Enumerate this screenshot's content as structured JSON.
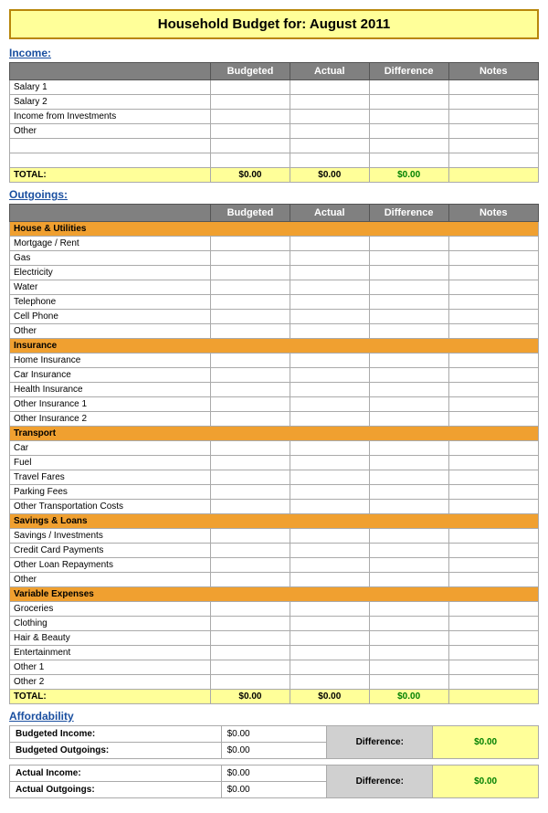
{
  "title": {
    "prefix": "Household Budget for:",
    "month": "August 2011",
    "full": "Household Budget for:   August 2011"
  },
  "income": {
    "section_label": "Income:",
    "headers": [
      "",
      "Budgeted",
      "Actual",
      "Difference",
      "Notes"
    ],
    "items": [
      "Salary 1",
      "Salary 2",
      "Income from Investments",
      "Other"
    ],
    "total_label": "TOTAL:",
    "total_budgeted": "$0.00",
    "total_actual": "$0.00",
    "total_difference": "$0.00"
  },
  "outgoings": {
    "section_label": "Outgoings:",
    "headers": [
      "",
      "Budgeted",
      "Actual",
      "Difference",
      "Notes"
    ],
    "categories": [
      {
        "name": "House & Utilities",
        "items": [
          "Mortgage / Rent",
          "Gas",
          "Electricity",
          "Water",
          "Telephone",
          "Cell Phone",
          "Other"
        ]
      },
      {
        "name": "Insurance",
        "items": [
          "Home Insurance",
          "Car Insurance",
          "Health Insurance",
          "Other Insurance 1",
          "Other Insurance 2"
        ]
      },
      {
        "name": "Transport",
        "items": [
          "Car",
          "Fuel",
          "Travel Fares",
          "Parking Fees",
          "Other Transportation Costs"
        ]
      },
      {
        "name": "Savings & Loans",
        "items": [
          "Savings / Investments",
          "Credit Card Payments",
          "Other Loan Repayments",
          "Other"
        ]
      },
      {
        "name": "Variable Expenses",
        "items": [
          "Groceries",
          "Clothing",
          "Hair & Beauty",
          "Entertainment",
          "Other 1",
          "Other 2"
        ]
      }
    ],
    "total_label": "TOTAL:",
    "total_budgeted": "$0.00",
    "total_actual": "$0.00",
    "total_difference": "$0.00"
  },
  "affordability": {
    "section_label": "Affordability",
    "budgeted_income_label": "Budgeted Income:",
    "budgeted_income_value": "$0.00",
    "budgeted_outgoings_label": "Budgeted Outgoings:",
    "budgeted_outgoings_value": "$0.00",
    "budgeted_diff_label": "Difference:",
    "budgeted_diff_value": "$0.00",
    "actual_income_label": "Actual Income:",
    "actual_income_value": "$0.00",
    "actual_outgoings_label": "Actual Outgoings:",
    "actual_outgoings_value": "$0.00",
    "actual_diff_label": "Difference:",
    "actual_diff_value": "$0.00"
  }
}
